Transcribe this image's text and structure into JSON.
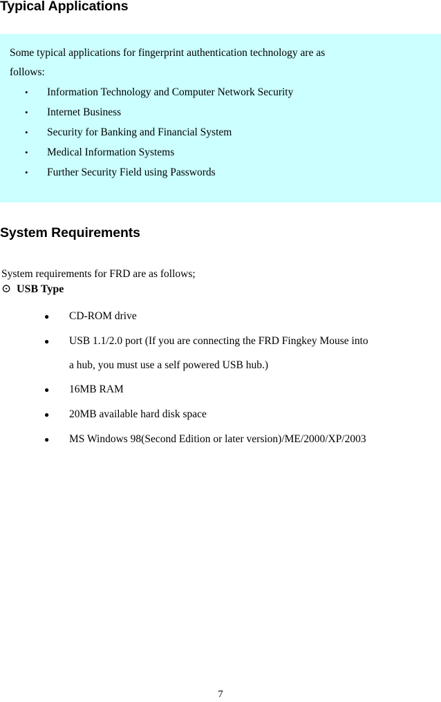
{
  "document": {
    "page_number": "7",
    "highlight_color": "#ccffff"
  },
  "sections": {
    "typical_applications": {
      "heading": "Typical Applications",
      "intro_main": "Some typical applications for fingerprint authentication technology are as",
      "intro_last": "follows:",
      "bullet_glyph": "•",
      "items": [
        "Information Technology and Computer Network Security",
        "Internet Business",
        "Security for Banking and Financial System",
        "Medical Information Systems",
        "Further Security Field using Passwords"
      ]
    },
    "system_requirements": {
      "heading": "System Requirements",
      "intro": "System requirements for FRD are as follows;",
      "subsection": {
        "marker_glyph": "⊙",
        "label": "USB Type",
        "bullet_glyph": "●",
        "items": [
          {
            "text": "CD-ROM drive",
            "wraps": false
          },
          {
            "text": "USB 1.1/2.0 port (If you are connecting the FRD Fingkey Mouse into",
            "continuation": "a hub, you must use a self powered USB hub.)",
            "wraps": true
          },
          {
            "text": "16MB RAM",
            "wraps": false
          },
          {
            "text": "20MB available hard disk space",
            "wraps": false
          },
          {
            "text": "MS Windows 98(Second Edition or later version)/ME/2000/XP/2003",
            "wraps": false
          }
        ]
      }
    }
  }
}
